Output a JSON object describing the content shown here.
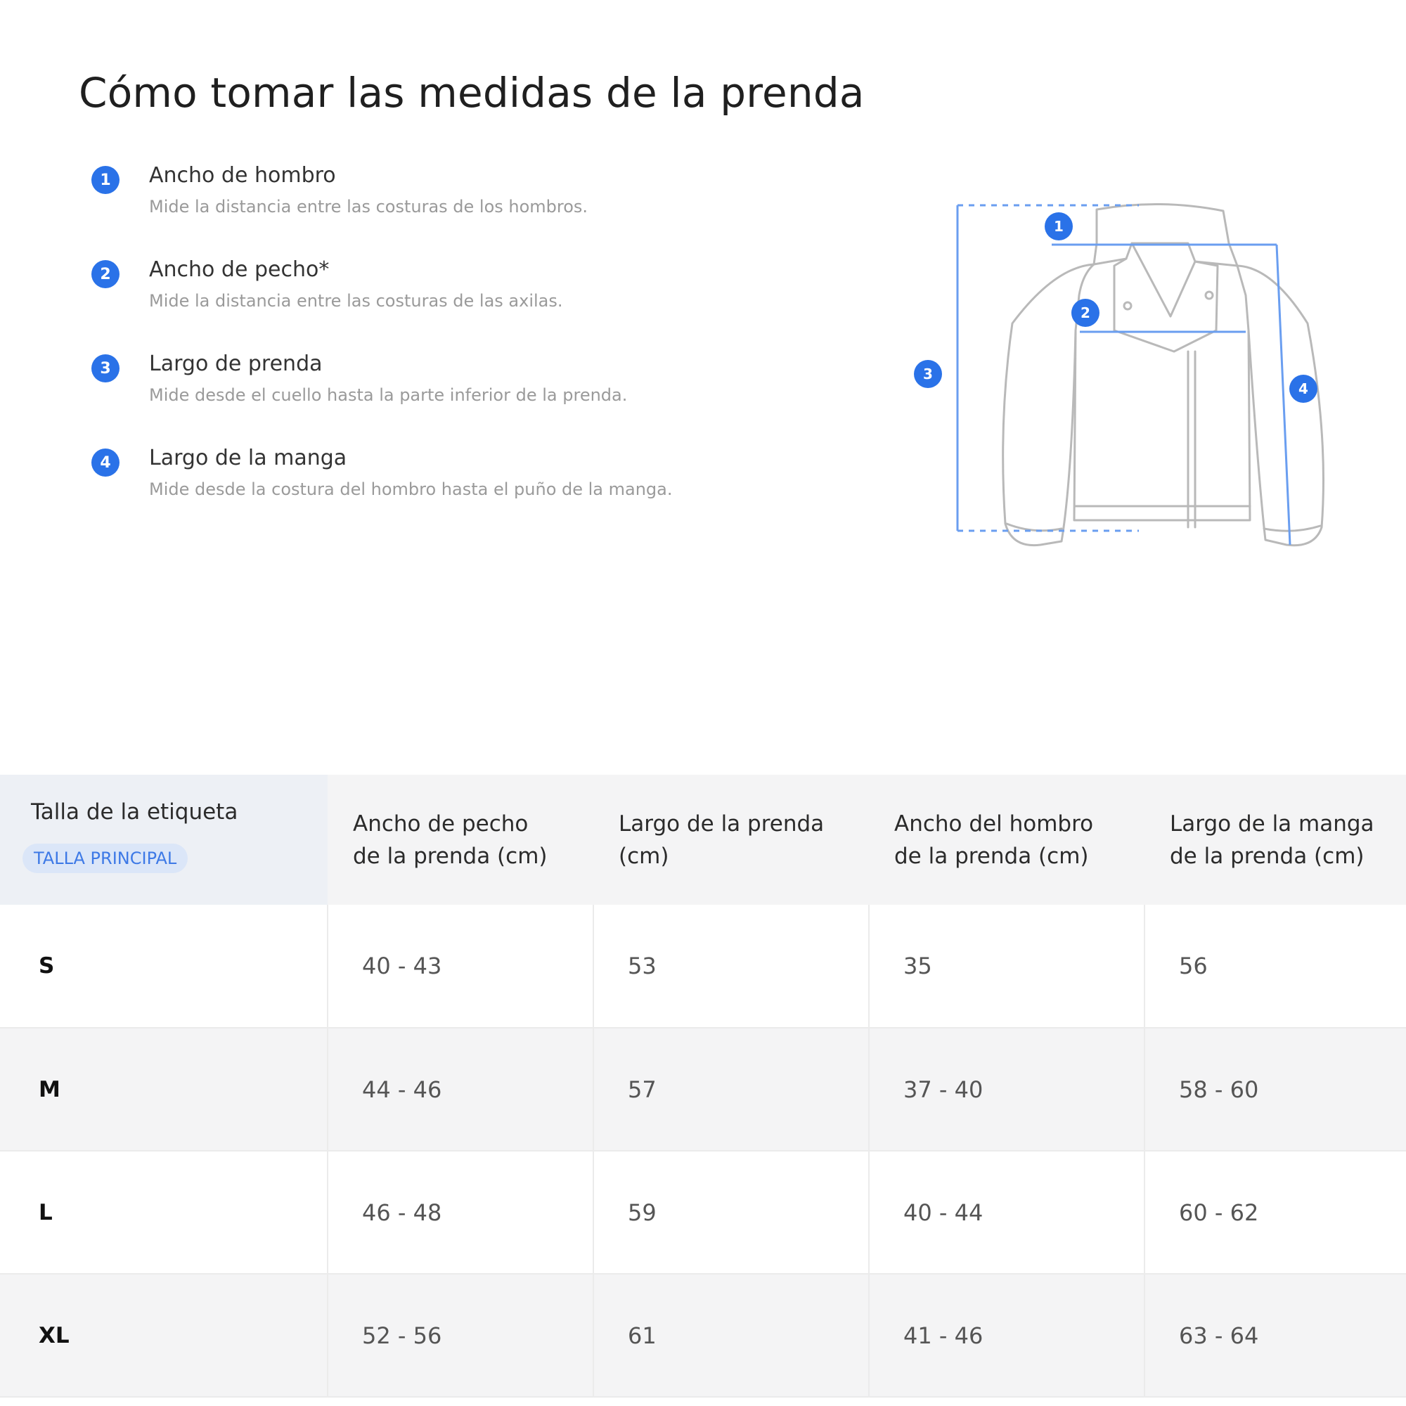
{
  "title": "Cómo tomar las medidas de la prenda",
  "instructions": [
    {
      "number": "1",
      "title": "Ancho de hombro",
      "description": "Mide la distancia entre las costuras de los hombros."
    },
    {
      "number": "2",
      "title": "Ancho de pecho*",
      "description": "Mide la distancia entre las costuras de las axilas."
    },
    {
      "number": "3",
      "title": "Largo de prenda",
      "description": "Mide desde el cuello hasta la parte inferior de la prenda."
    },
    {
      "number": "4",
      "title": "Largo de la manga",
      "description": "Mide desde la costura del hombro hasta el puño de la manga."
    }
  ],
  "diagram": {
    "icon": "jacket-measurement-icon",
    "markers": [
      "1",
      "2",
      "3",
      "4"
    ],
    "line_color": "#6a9ef0",
    "badge_color": "#2a72e8"
  },
  "table": {
    "header": {
      "size_label": "Talla de la etiqueta",
      "size_sub": "TALLA PRINCIPAL",
      "columns": [
        {
          "line1": "Ancho de pecho",
          "line2": "de la prenda (cm)"
        },
        {
          "line1": "Largo de la prenda",
          "line2": "(cm)"
        },
        {
          "line1": "Ancho del hombro",
          "line2": "de la prenda (cm)"
        },
        {
          "line1": "Largo de la manga",
          "line2": "de la prenda (cm)"
        }
      ]
    },
    "rows": [
      {
        "size": "S",
        "values": [
          "40 - 43",
          "53",
          "35",
          "56"
        ]
      },
      {
        "size": "M",
        "values": [
          "44 - 46",
          "57",
          "37 - 40",
          "58 - 60"
        ]
      },
      {
        "size": "L",
        "values": [
          "46 - 48",
          "59",
          "40 - 44",
          "60 - 62"
        ]
      },
      {
        "size": "XL",
        "values": [
          "52 - 56",
          "61",
          "41 - 46",
          "63 - 64"
        ]
      }
    ]
  }
}
